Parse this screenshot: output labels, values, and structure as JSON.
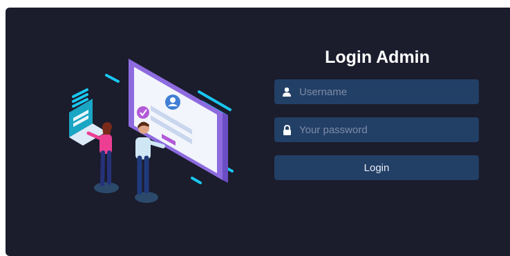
{
  "login": {
    "title": "Login Admin",
    "username_placeholder": "Username",
    "password_placeholder": "Your password",
    "button_label": "Login"
  },
  "colors": {
    "card_background": "#1b1c2c",
    "field_background": "#223f66",
    "accent_purple": "#8d6bdf",
    "accent_cyan": "#19c7f0",
    "accent_pink": "#ee3f8f"
  },
  "icons": {
    "username": "user-icon",
    "password": "lock-icon",
    "illustration": "login-illustration"
  }
}
